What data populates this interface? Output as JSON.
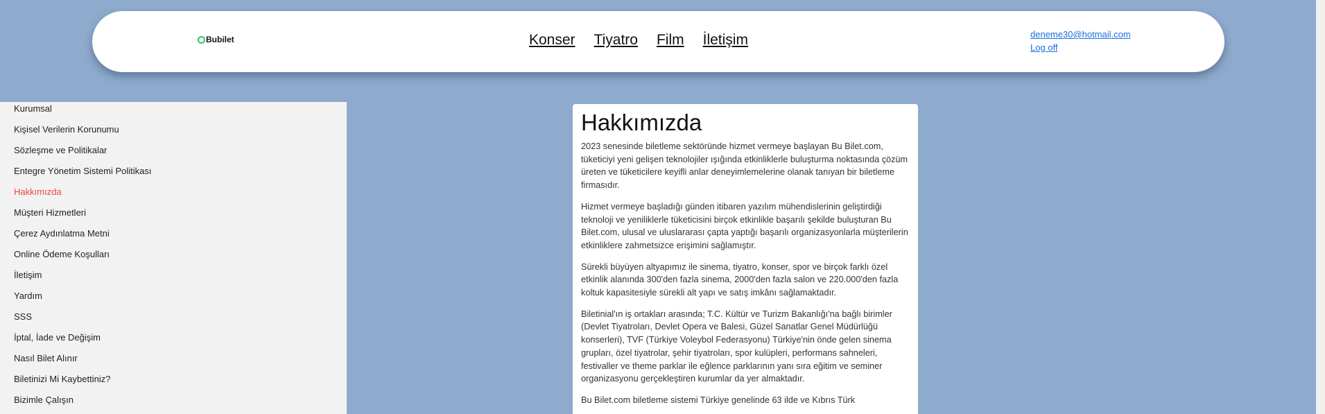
{
  "header": {
    "logo_text": "Bubilet",
    "nav": [
      "Konser",
      "Tiyatro",
      "Film",
      "İletişim"
    ],
    "user_email": "deneme30@hotmail.com",
    "logoff_label": "Log off"
  },
  "sidebar": {
    "items": [
      "Kurumsal",
      "Kişisel Verilerin Korunumu",
      "Sözleşme ve Politikalar",
      "Entegre Yönetim Sistemi Politikası",
      "Hakkımızda",
      "Müşteri Hizmetleri",
      "Çerez Aydınlatma Metni",
      "Online Ödeme Koşulları",
      "İletişim",
      "Yardım",
      "SSS",
      "İptal, İade ve Değişim",
      "Nasıl Bilet Alınır",
      "Biletinizi Mi Kaybettiniz?",
      "Bizimle Çalışın"
    ],
    "active_item": "Hakkımızda",
    "active_color": "#e8483a"
  },
  "main": {
    "title": "Hakkımızda",
    "paragraphs": [
      "2023 senesinde biletleme sektöründe hizmet vermeye başlayan Bu Bilet.com, tüketiciyi yeni gelişen teknolojiler ışığında etkinliklerle buluşturma noktasında çözüm üreten ve tüketicilere keyifli anlar deneyimlemelerine olanak tanıyan bir biletleme firmasıdır.",
      "Hizmet vermeye başladığı günden itibaren yazılım mühendislerinin geliştirdiği teknoloji ve yeniliklerle tüketicisini birçok etkinlikle başarılı şekilde buluşturan Bu Bilet.com, ulusal ve uluslararası çapta yaptığı başarılı organizasyonlarla müşterilerin etkinliklere zahmetsizce erişimini sağlamıştır.",
      "Sürekli büyüyen altyapımız ile sinema, tiyatro, konser, spor ve birçok farklı özel etkinlik alanında 300'den fazla sinema, 2000'den fazla salon ve 220.000'den fazla koltuk kapasitesiyle sürekli alt yapı ve satış imkânı sağlamaktadır.",
      "Biletinial'ın iş ortakları arasında; T.C. Kültür ve Turizm Bakanlığı'na bağlı birimler (Devlet Tiyatroları, Devlet Opera ve Balesi, Güzel Sanatlar Genel Müdürlüğü konserleri), TVF (Türkiye Voleybol Federasyonu) Türkiye'nin önde gelen sinema grupları, özel tiyatrolar, şehir tiyatroları, spor kulüpleri, performans sahneleri, festivaller ve theme parklar ile eğlence parklarının yanı sıra eğitim ve seminer organizasyonu gerçekleştiren kurumlar da yer almaktadır.",
      "Bu Bilet.com biletleme sistemi Türkiye genelinde 63 ilde ve Kıbrıs Türk"
    ]
  }
}
